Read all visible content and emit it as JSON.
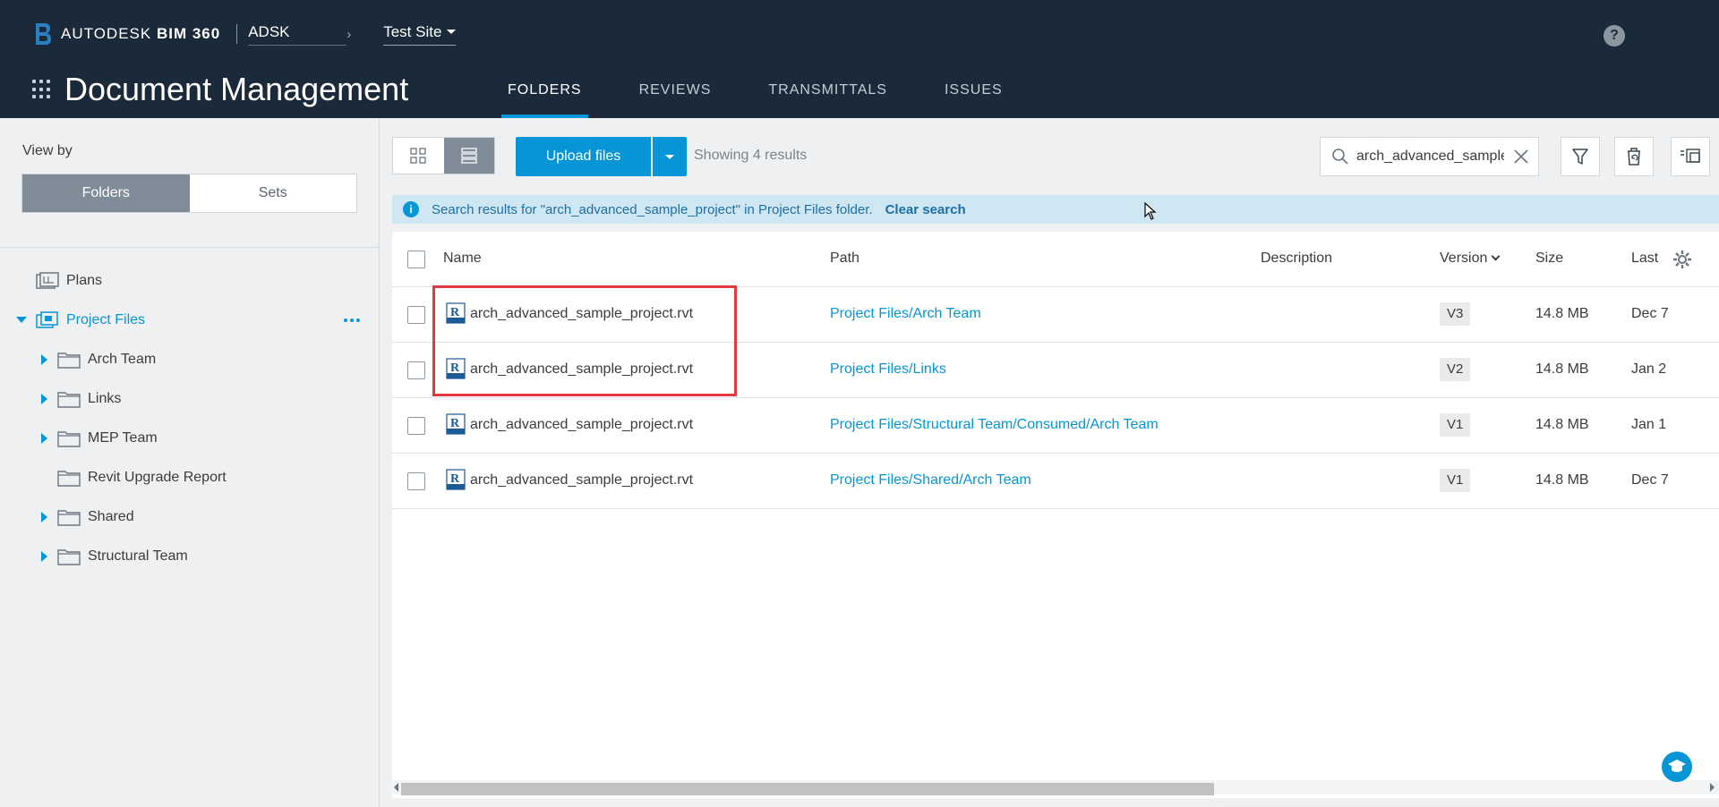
{
  "header": {
    "brand_prefix": "AUTODESK",
    "brand_product": "BIM 360",
    "account": "ADSK",
    "project": "Test Site",
    "help": "?",
    "app_title": "Document Management",
    "tabs": [
      {
        "label": "FOLDERS",
        "active": true
      },
      {
        "label": "REVIEWS",
        "active": false
      },
      {
        "label": "TRANSMITTALS",
        "active": false
      },
      {
        "label": "ISSUES",
        "active": false
      }
    ]
  },
  "sidebar": {
    "view_by_label": "View by",
    "segments": {
      "folders": "Folders",
      "sets": "Sets"
    },
    "tree": {
      "plans": "Plans",
      "project_files": "Project Files",
      "children": [
        "Arch Team",
        "Links",
        "MEP Team",
        "Revit Upgrade Report",
        "Shared",
        "Structural Team"
      ]
    }
  },
  "toolbar": {
    "upload_label": "Upload files",
    "results_text": "Showing 4 results",
    "search_value": "arch_advanced_sample_project"
  },
  "banner": {
    "text": "Search results for \"arch_advanced_sample_project\" in Project Files folder.",
    "clear_label": "Clear search"
  },
  "table": {
    "columns": {
      "name": "Name",
      "path": "Path",
      "description": "Description",
      "version": "Version",
      "size": "Size",
      "last": "Last"
    },
    "rows": [
      {
        "name": "arch_advanced_sample_project.rvt",
        "path": "Project Files/Arch Team",
        "description": "",
        "version": "V3",
        "size": "14.8 MB",
        "last": "Dec 7"
      },
      {
        "name": "arch_advanced_sample_project.rvt",
        "path": "Project Files/Links",
        "description": "",
        "version": "V2",
        "size": "14.8 MB",
        "last": "Jan 2"
      },
      {
        "name": "arch_advanced_sample_project.rvt",
        "path": "Project Files/Structural Team/Consumed/Arch Team",
        "description": "",
        "version": "V1",
        "size": "14.8 MB",
        "last": "Jan 1"
      },
      {
        "name": "arch_advanced_sample_project.rvt",
        "path": "Project Files/Shared/Arch Team",
        "description": "",
        "version": "V1",
        "size": "14.8 MB",
        "last": "Dec 7"
      }
    ]
  },
  "colors": {
    "header_bg": "#1b2a3a",
    "accent": "#0696d7",
    "banner_bg": "#cfe6f3",
    "highlight": "#e0393e"
  }
}
